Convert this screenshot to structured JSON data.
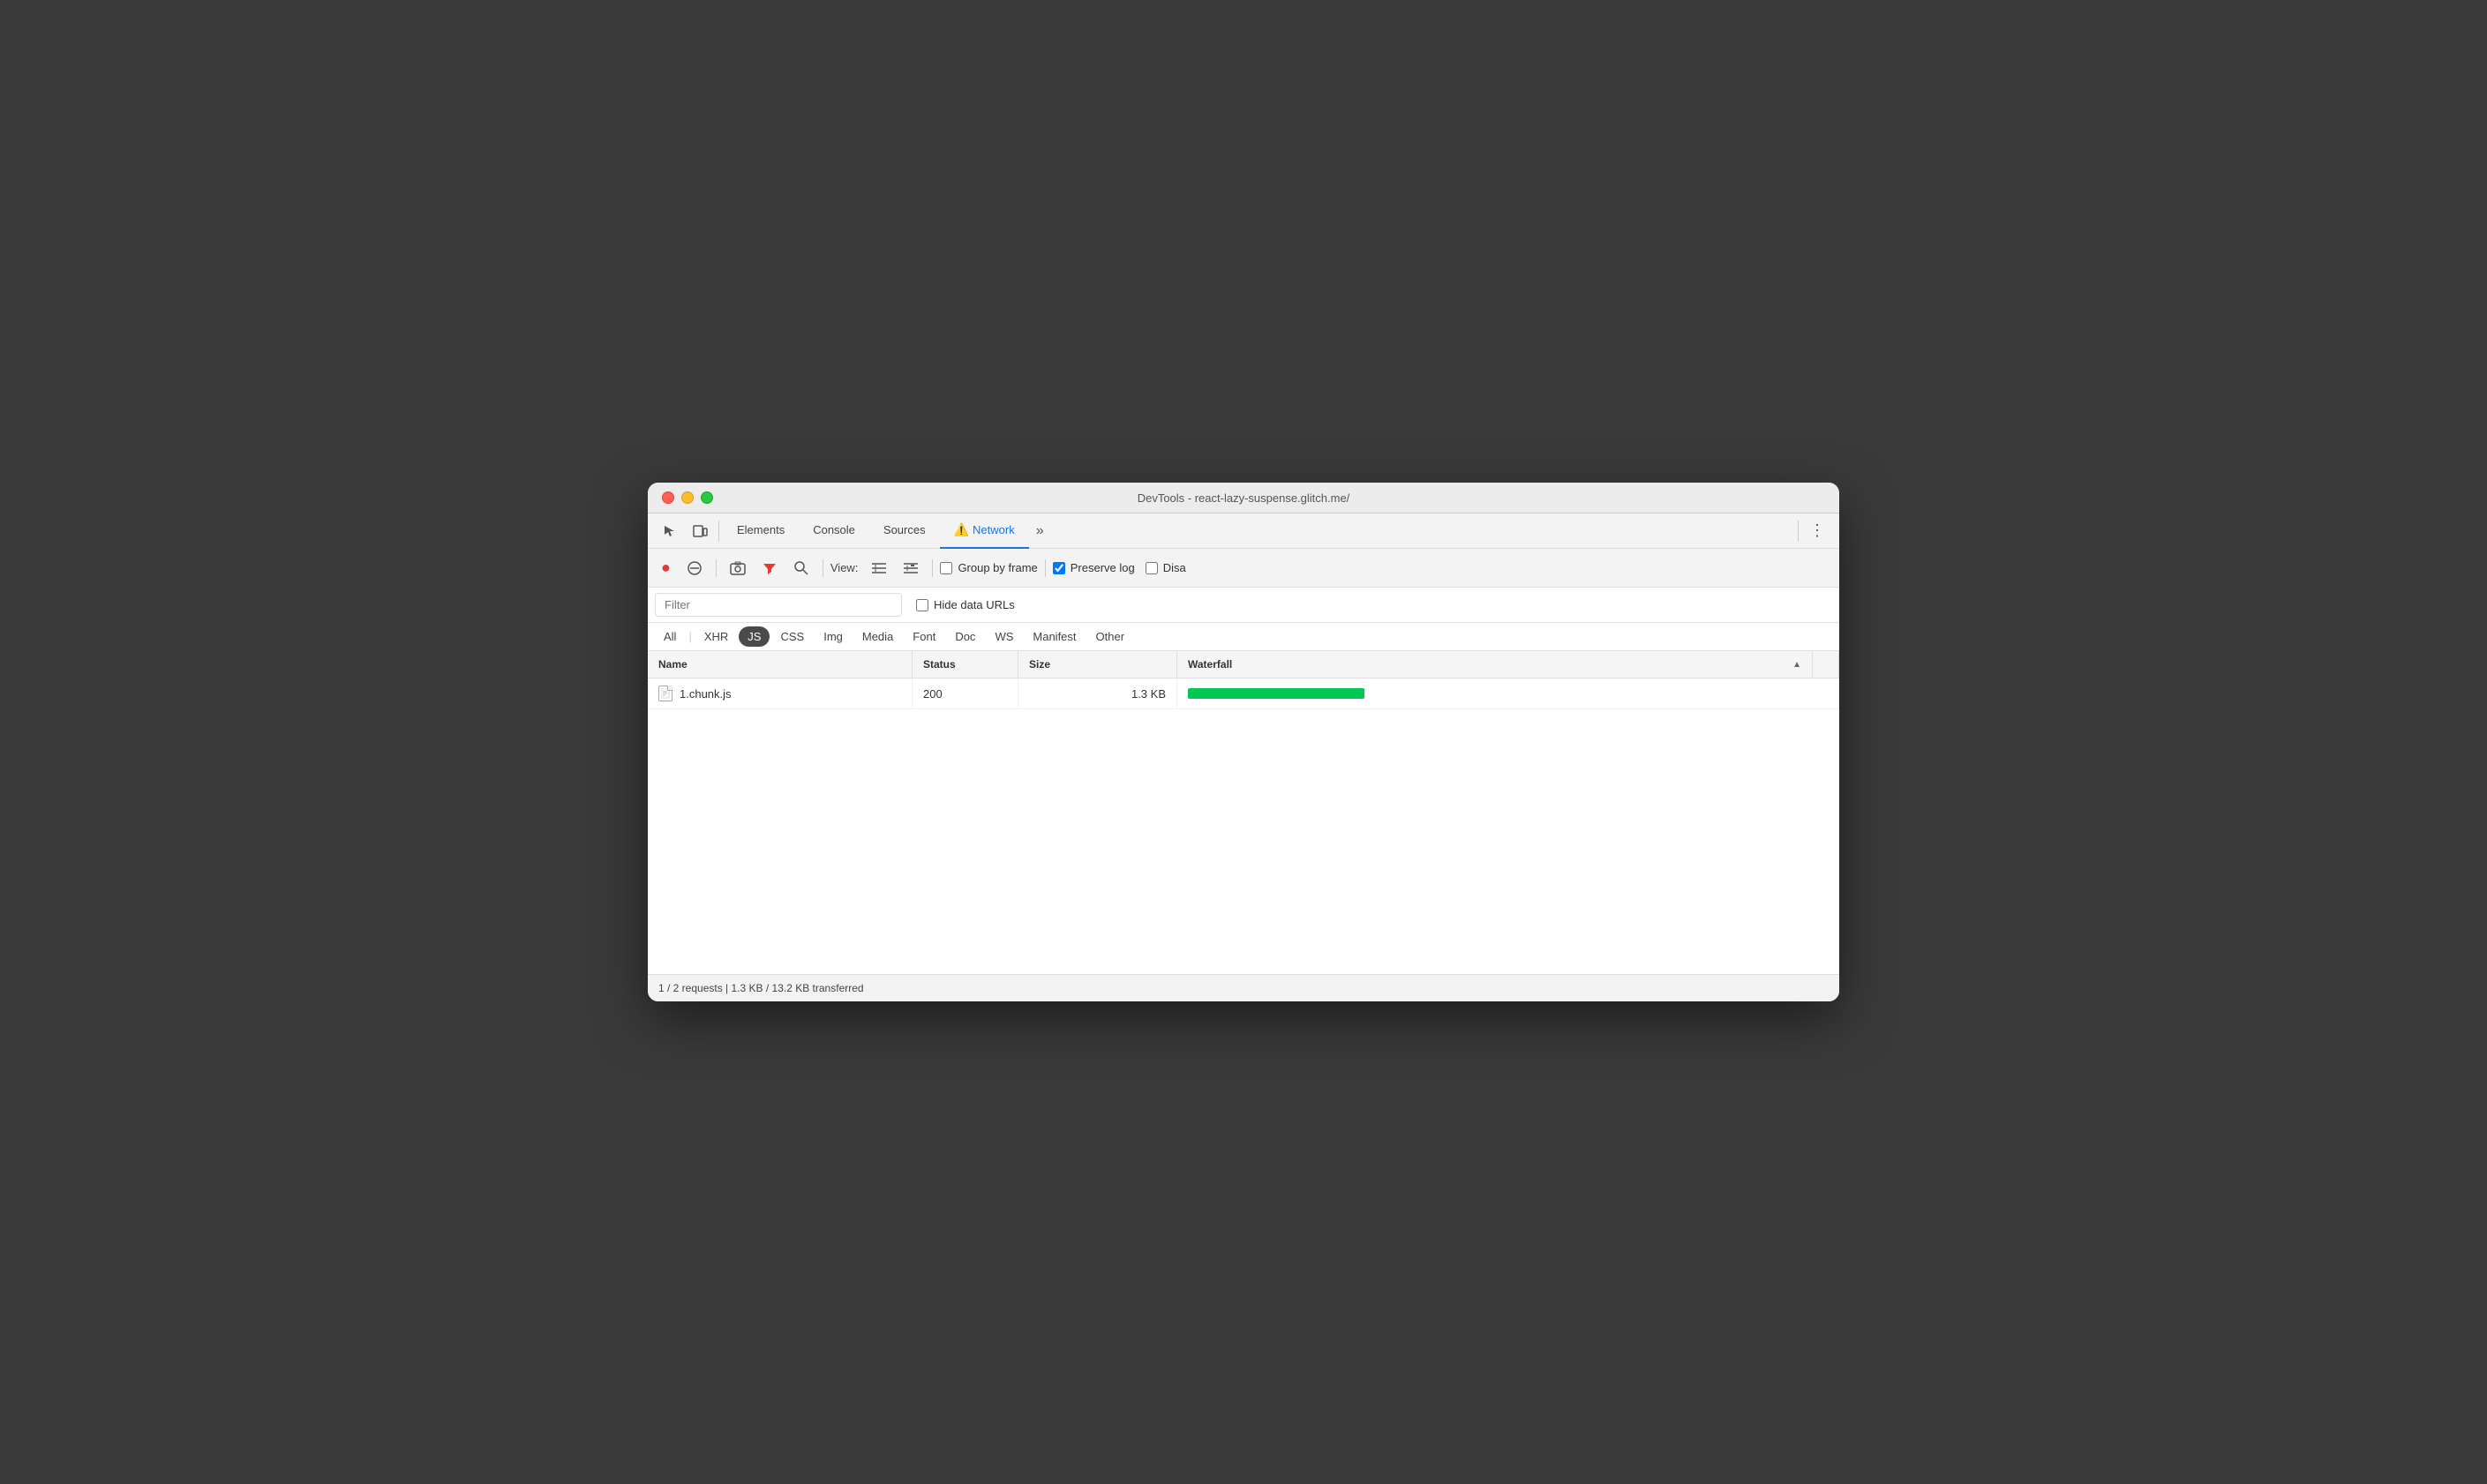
{
  "window": {
    "title": "DevTools - react-lazy-suspense.glitch.me/"
  },
  "traffic_lights": {
    "close_label": "close",
    "minimize_label": "minimize",
    "maximize_label": "maximize"
  },
  "tabs": {
    "items": [
      {
        "id": "elements",
        "label": "Elements",
        "active": false
      },
      {
        "id": "console",
        "label": "Console",
        "active": false
      },
      {
        "id": "sources",
        "label": "Sources",
        "active": false
      },
      {
        "id": "network",
        "label": "Network",
        "active": true,
        "warning": "⚠️"
      },
      {
        "id": "more",
        "label": "»",
        "active": false
      }
    ]
  },
  "toolbar": {
    "record_label": "●",
    "clear_label": "🚫",
    "camera_label": "📷",
    "filter_label": "▼",
    "search_label": "🔍",
    "view_label": "View:",
    "list_view_label": "☰",
    "tree_view_label": "⋮⋮",
    "group_by_frame_label": "Group by frame",
    "group_by_frame_checked": false,
    "preserve_log_label": "Preserve log",
    "preserve_log_checked": true,
    "disable_cache_label": "Disa"
  },
  "filter": {
    "placeholder": "Filter",
    "hide_data_urls_label": "Hide data URLs",
    "hide_data_urls_checked": false
  },
  "type_filters": [
    {
      "id": "all",
      "label": "All",
      "active": false
    },
    {
      "id": "xhr",
      "label": "XHR",
      "active": false
    },
    {
      "id": "js",
      "label": "JS",
      "active": true
    },
    {
      "id": "css",
      "label": "CSS",
      "active": false
    },
    {
      "id": "img",
      "label": "Img",
      "active": false
    },
    {
      "id": "media",
      "label": "Media",
      "active": false
    },
    {
      "id": "font",
      "label": "Font",
      "active": false
    },
    {
      "id": "doc",
      "label": "Doc",
      "active": false
    },
    {
      "id": "ws",
      "label": "WS",
      "active": false
    },
    {
      "id": "manifest",
      "label": "Manifest",
      "active": false
    },
    {
      "id": "other",
      "label": "Other",
      "active": false
    }
  ],
  "table": {
    "columns": [
      {
        "id": "name",
        "label": "Name"
      },
      {
        "id": "status",
        "label": "Status"
      },
      {
        "id": "size",
        "label": "Size"
      },
      {
        "id": "waterfall",
        "label": "Waterfall"
      }
    ],
    "rows": [
      {
        "name": "1.chunk.js",
        "status": "200",
        "size": "1.3 KB",
        "waterfall_width": 200
      }
    ]
  },
  "status_bar": {
    "text": "1 / 2 requests | 1.3 KB / 13.2 KB transferred"
  },
  "colors": {
    "active_tab_underline": "#1a73e8",
    "record_button": "#e53935",
    "waterfall_bar": "#00c853",
    "active_type_btn_bg": "#4a4a4a",
    "active_type_btn_text": "#ffffff"
  }
}
